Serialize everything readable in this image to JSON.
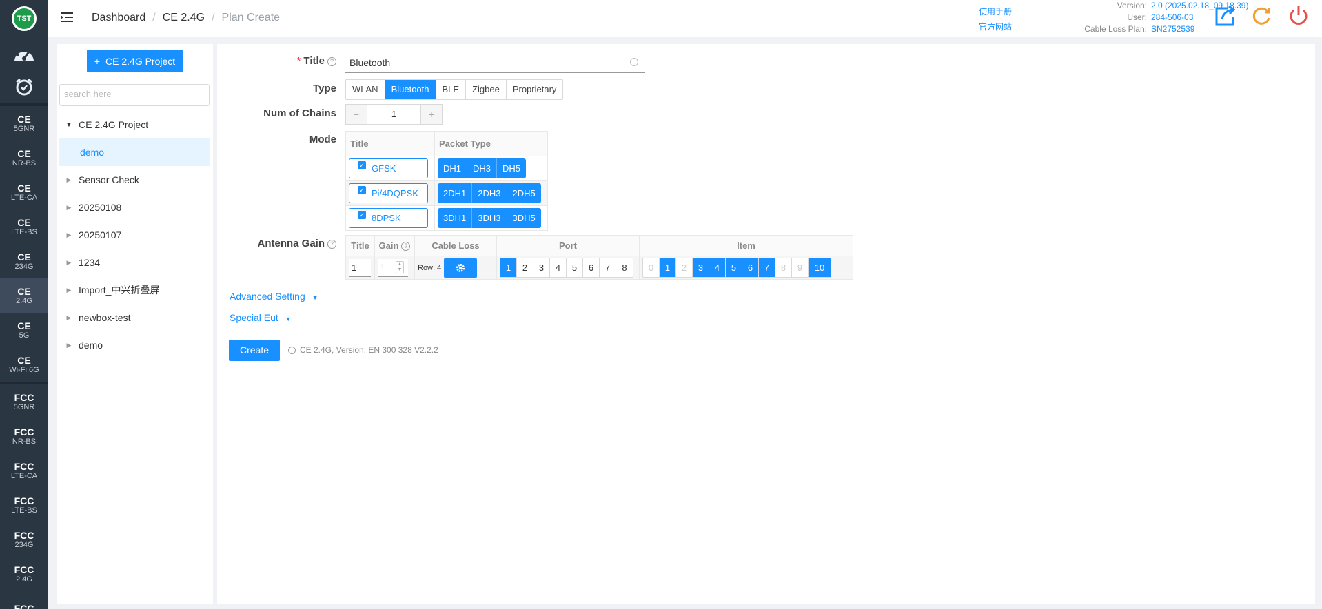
{
  "app": {
    "logo_text": "TST"
  },
  "rail": {
    "items": [
      {
        "a": "CE",
        "b": "5GNR"
      },
      {
        "a": "CE",
        "b": "NR-BS"
      },
      {
        "a": "CE",
        "b": "LTE-CA"
      },
      {
        "a": "CE",
        "b": "LTE-BS"
      },
      {
        "a": "CE",
        "b": "234G"
      },
      {
        "a": "CE",
        "b": "2.4G"
      },
      {
        "a": "CE",
        "b": "5G"
      },
      {
        "a": "CE",
        "b": "Wi-Fi 6G"
      },
      {
        "a": "FCC",
        "b": "5GNR"
      },
      {
        "a": "FCC",
        "b": "NR-BS"
      },
      {
        "a": "FCC",
        "b": "LTE-CA"
      },
      {
        "a": "FCC",
        "b": "LTE-BS"
      },
      {
        "a": "FCC",
        "b": "234G"
      },
      {
        "a": "FCC",
        "b": "2.4G"
      },
      {
        "a": "FCC",
        "b": ""
      }
    ],
    "active_index": 5
  },
  "breadcrumb": {
    "home": "Dashboard",
    "section": "CE 2.4G",
    "current": "Plan Create"
  },
  "header_links": {
    "manual": "使用手册",
    "website": "官方网站"
  },
  "meta": {
    "version_label": "Version:",
    "version": "2.0 (2025.02.18_09.18.39)",
    "user_label": "User:",
    "user": "284-506-03",
    "cable_label": "Cable Loss Plan:",
    "cable": "SN2752539"
  },
  "colors": {
    "accent": "#1890ff",
    "rail": "#2b3643",
    "export": "#1890ff",
    "refresh": "#f0a030",
    "power": "#e8504a"
  },
  "panel": {
    "new_button": "CE 2.4G Project",
    "search_placeholder": "search here",
    "tree": [
      {
        "label": "CE 2.4G Project",
        "expanded": true
      },
      {
        "label": "demo",
        "child": true
      },
      {
        "label": "Sensor Check"
      },
      {
        "label": "20250108"
      },
      {
        "label": "20250107"
      },
      {
        "label": "1234"
      },
      {
        "label": "Import_中兴折叠屏"
      },
      {
        "label": "newbox-test"
      },
      {
        "label": "demo"
      }
    ]
  },
  "form": {
    "title_label": "Title",
    "title_value": "Bluetooth",
    "type_label": "Type",
    "types": [
      "WLAN",
      "Bluetooth",
      "BLE",
      "Zigbee",
      "Proprietary"
    ],
    "type_selected": "Bluetooth",
    "chains_label": "Num of Chains",
    "chains_value": "1",
    "mode_label": "Mode",
    "mode_headers": {
      "title": "Title",
      "packet": "Packet Type"
    },
    "modes": [
      {
        "title": "GFSK",
        "packets": [
          "DH1",
          "DH3",
          "DH5"
        ]
      },
      {
        "title": "Pi/4DQPSK",
        "packets": [
          "2DH1",
          "2DH3",
          "2DH5"
        ]
      },
      {
        "title": "8DPSK",
        "packets": [
          "3DH1",
          "3DH3",
          "3DH5"
        ]
      }
    ],
    "antenna_label": "Antenna Gain",
    "antenna_headers": {
      "title": "Title",
      "gain": "Gain",
      "cable": "Cable Loss",
      "port": "Port",
      "item": "Item"
    },
    "antenna_row": {
      "title": "1",
      "gain": "1",
      "cable_row": "Row: 4",
      "ports": [
        "1",
        "2",
        "3",
        "4",
        "5",
        "6",
        "7",
        "8"
      ],
      "port_selected": [
        "1"
      ],
      "items": [
        "0",
        "1",
        "2",
        "3",
        "4",
        "5",
        "6",
        "7",
        "8",
        "9",
        "10"
      ],
      "items_selected": [
        "1",
        "3",
        "4",
        "5",
        "6",
        "7",
        "10"
      ],
      "items_disabled": [
        "0",
        "2",
        "8",
        "9"
      ]
    },
    "advanced": "Advanced Setting",
    "special": "Special Eut",
    "create": "Create",
    "note": "CE 2.4G, Version: EN 300 328 V2.2.2"
  }
}
